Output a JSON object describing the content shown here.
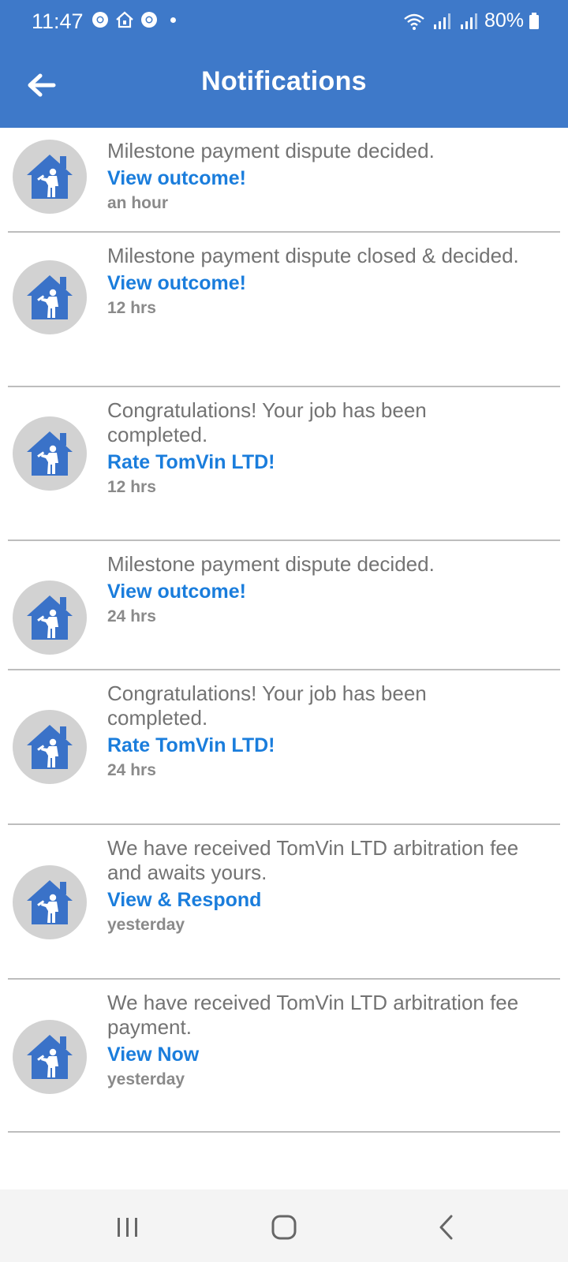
{
  "status_bar": {
    "time": "11:47",
    "battery": "80%"
  },
  "header": {
    "title": "Notifications"
  },
  "notifications": [
    {
      "message": "Milestone payment dispute decided.",
      "action": "View outcome!",
      "time": "an hour"
    },
    {
      "message": "Milestone payment dispute closed & decided.",
      "action": "View outcome!",
      "time": "12 hrs"
    },
    {
      "message": "Congratulations! Your job has been completed.",
      "action": "Rate TomVin LTD!",
      "time": "12 hrs"
    },
    {
      "message": "Milestone payment dispute decided.",
      "action": "View outcome!",
      "time": "24 hrs"
    },
    {
      "message": "Congratulations! Your job has been completed.",
      "action": "Rate TomVin LTD!",
      "time": "24 hrs"
    },
    {
      "message": "We have received TomVin LTD arbitration fee and awaits yours.",
      "action": "View & Respond",
      "time": "yesterday"
    },
    {
      "message": "We have received TomVin LTD arbitration fee payment.",
      "action": "View Now",
      "time": "yesterday"
    }
  ],
  "icons": {
    "avatar": "house-worker-icon",
    "back": "arrow-left-icon",
    "nav_recents": "recent-apps-icon",
    "nav_home": "home-icon",
    "nav_back": "chevron-left-icon"
  },
  "colors": {
    "header_bg": "#3e79c9",
    "accent": "#1a7ddc",
    "message_text": "#737373",
    "avatar_bg": "#d2d2d2",
    "icon_blue": "#3a72c8"
  }
}
